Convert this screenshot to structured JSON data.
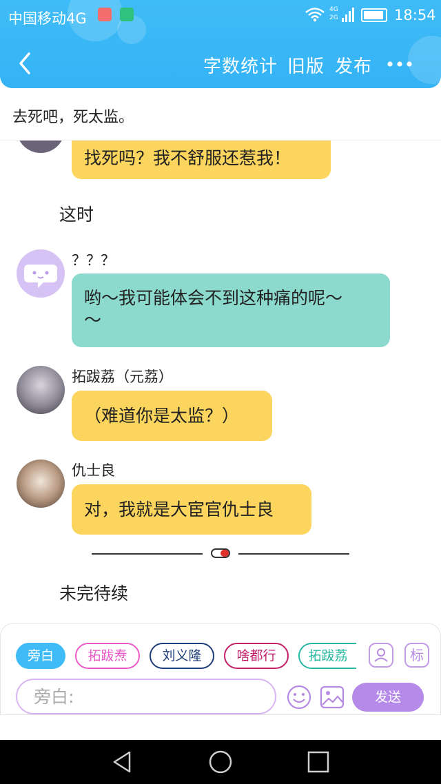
{
  "status_bar": {
    "carrier": "中国移动4G",
    "time": "18:54",
    "network_labels": [
      "4G",
      "2G"
    ],
    "icons": [
      "app-notification-icon",
      "app-notification-icon",
      "wifi-icon",
      "signal-icon",
      "battery-charging-icon"
    ]
  },
  "toolbar": {
    "back_icon": "chevron-left-icon",
    "word_count_label": "字数统计",
    "old_version_label": "旧版",
    "publish_label": "发布",
    "more_icon": "more-dots-icon",
    "accent_color": "#3fbcf7"
  },
  "story": {
    "title": "去死吧，死太监。"
  },
  "messages": [
    {
      "type": "dialogue",
      "speaker": "",
      "text": "找死吗？我不舒服还惹我！",
      "bubble_color": "#fcd55e",
      "partially_hidden": true
    },
    {
      "type": "narration",
      "text": "这时"
    },
    {
      "type": "dialogue",
      "speaker": "？？？",
      "avatar": "chat-bubble-icon",
      "text_line1": "哟～我可能体会不到这种痛的呢～",
      "text_line2": "～",
      "bubble_color": "#8cd9cd"
    },
    {
      "type": "dialogue",
      "speaker": "拓跋荔（元荔）",
      "avatar": "character-portrait",
      "text": "（难道你是太监？）",
      "bubble_color": "#fcd55e"
    },
    {
      "type": "dialogue",
      "speaker": "仇士良",
      "avatar": "dog-photo",
      "text": "对，我就是大宦官仇士良",
      "bubble_color": "#fcd55e"
    },
    {
      "type": "divider",
      "icon": "toggle-icon"
    },
    {
      "type": "narration",
      "text": "未完待续"
    }
  ],
  "composer": {
    "roles": [
      {
        "label": "旁白",
        "color": "#3fbcf7",
        "selected": true
      },
      {
        "label": "拓跋焘",
        "color": "#e85ac7",
        "selected": false
      },
      {
        "label": "刘义隆",
        "color": "#1f3d7a",
        "selected": false
      },
      {
        "label": "啥都行",
        "color": "#c21f6b",
        "selected": false
      },
      {
        "label": "拓跋荔",
        "color": "#26b8a1",
        "selected": false
      }
    ],
    "role_manage_icon": "person-card-icon",
    "tag_label": "标",
    "input_placeholder": "旁白:",
    "input_value": "",
    "emoji_icon": "smiley-icon",
    "image_icon": "image-icon",
    "send_label": "发送",
    "send_color": "#b58ae8"
  },
  "system_nav": {
    "icons": [
      "back-triangle-icon",
      "home-circle-icon",
      "recent-square-icon"
    ]
  }
}
